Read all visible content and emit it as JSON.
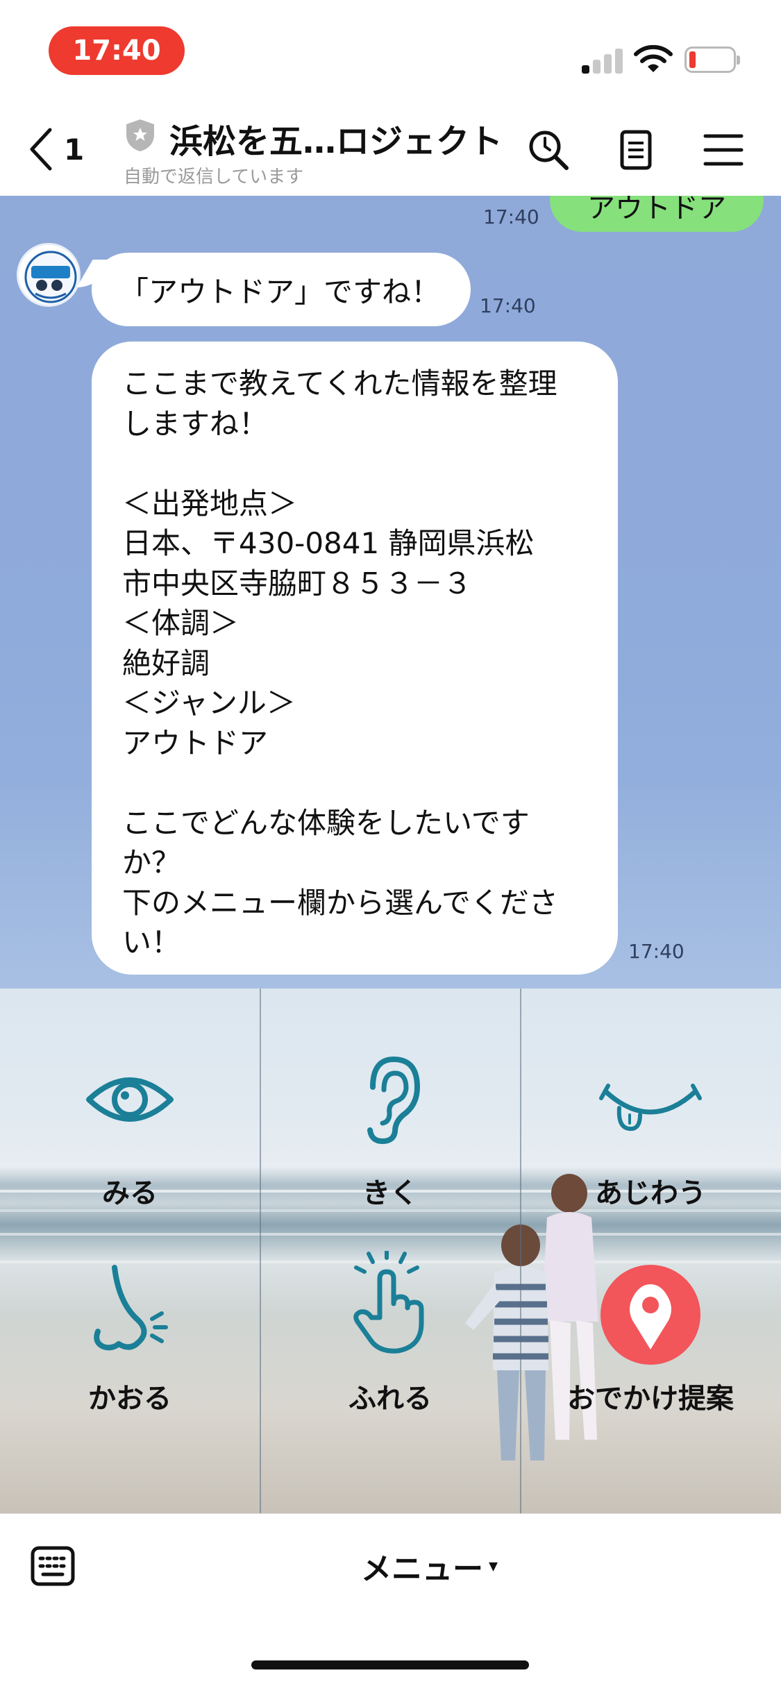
{
  "status_bar": {
    "time": "17:40"
  },
  "header": {
    "back_count": "1",
    "title": "浜松を五…ロジェクト",
    "subtitle": "自動で返信しています"
  },
  "chat": {
    "sent_message": "アウトドア",
    "sent_time": "17:40",
    "reply1": "「アウトドア」ですね！",
    "reply1_time": "17:40",
    "reply2_lines": [
      "ここまで教えてくれた情報を整理",
      "しますね！",
      "",
      "＜出発地点＞",
      "日本、〒430-0841 静岡県浜松",
      "市中央区寺脇町８５３－３",
      "＜体調＞",
      "絶好調",
      "＜ジャンル＞",
      "アウトドア",
      "",
      "ここでどんな体験をしたいです",
      "か？",
      "下のメニュー欄から選んでくださ",
      "い！"
    ],
    "reply2_time": "17:40"
  },
  "rich_menu": {
    "items": [
      {
        "label": "みる",
        "icon": "eye-icon"
      },
      {
        "label": "きく",
        "icon": "ear-icon"
      },
      {
        "label": "あじわう",
        "icon": "tongue-icon"
      },
      {
        "label": "かおる",
        "icon": "nose-icon"
      },
      {
        "label": "ふれる",
        "icon": "hand-icon"
      },
      {
        "label": "おでかけ提案",
        "icon": "map-pin-icon"
      }
    ],
    "icon_color": "#1a7f97",
    "pin_color": "#f2555a"
  },
  "bottom_bar": {
    "menu_label": "メニュー",
    "caret": "▾"
  },
  "colors": {
    "time_pill": "#ee3a2f",
    "chat_background": "#8fa9d9",
    "sent_bubble": "#86e07c"
  }
}
